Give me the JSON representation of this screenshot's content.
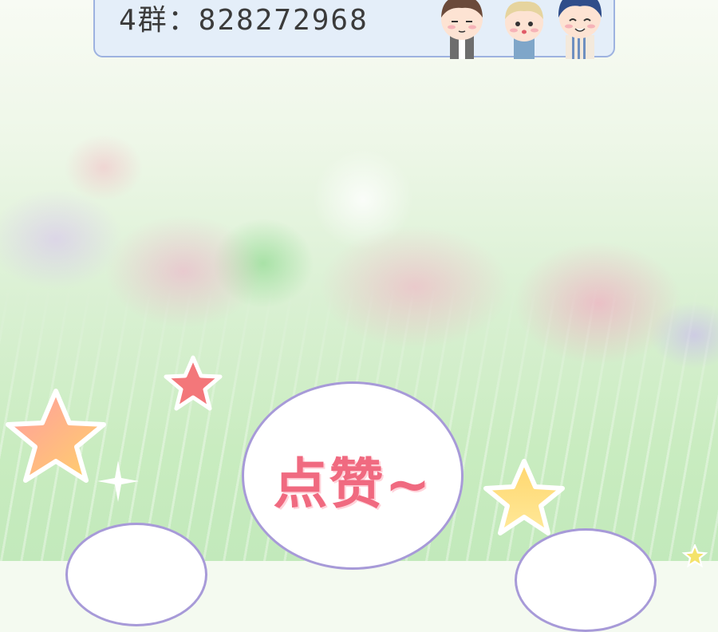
{
  "banner": {
    "group_text": "4群：828272968"
  },
  "bubble": {
    "like_text": "点赞~"
  },
  "colors": {
    "banner_bg": "#e4eef9",
    "banner_border": "#9db2e0",
    "bubble_border": "#a79ad8",
    "like_text": "#f06a80"
  }
}
